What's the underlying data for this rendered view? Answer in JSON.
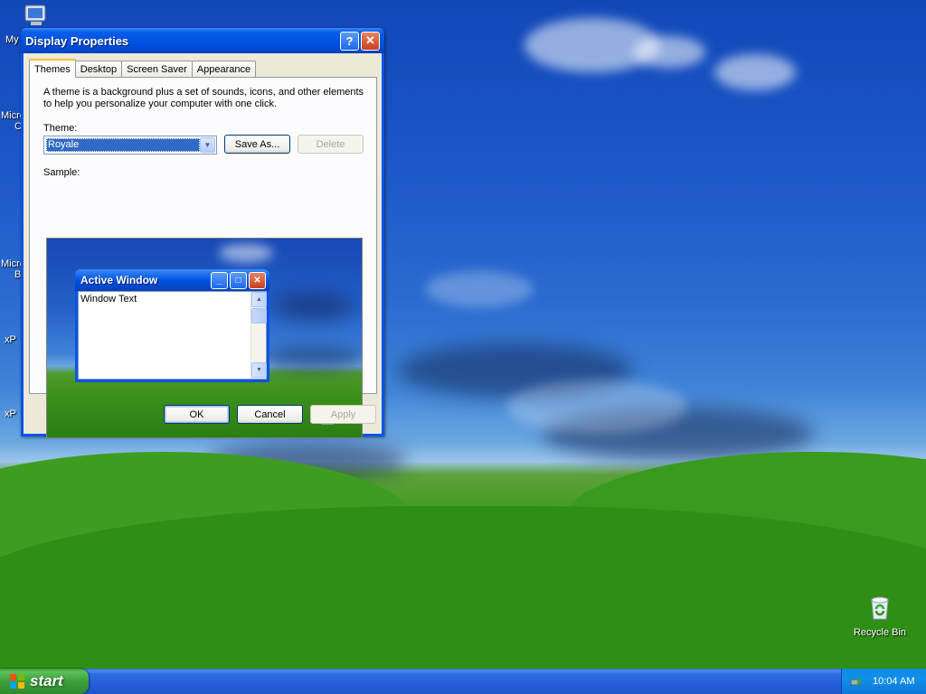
{
  "desktop": {
    "icons": [
      {
        "label": "Recycle Bin",
        "icon": "recycle-bin-icon"
      }
    ],
    "partial_labels": [
      "My",
      "Micro",
      "C",
      "Micro",
      "B",
      "xP",
      "xP"
    ]
  },
  "dialog": {
    "title": "Display Properties",
    "help_label": "?",
    "close_label": "✕",
    "tabs": [
      {
        "label": "Themes",
        "active": true
      },
      {
        "label": "Desktop",
        "active": false
      },
      {
        "label": "Screen Saver",
        "active": false
      },
      {
        "label": "Appearance",
        "active": false
      }
    ],
    "description": "A theme is a background plus a set of sounds, icons, and other elements to help you personalize your computer with one click.",
    "theme_label": "Theme:",
    "theme_value": "Royale",
    "save_as_label": "Save As...",
    "delete_label": "Delete",
    "sample_label": "Sample:",
    "sample": {
      "window_title": "Active Window",
      "window_text": "Window Text"
    },
    "ok_label": "OK",
    "cancel_label": "Cancel",
    "apply_label": "Apply"
  },
  "taskbar": {
    "start_label": "start",
    "clock": "10:04 AM"
  },
  "colors": {
    "title_bar": "#0054e3",
    "dialog_face": "#ece9d8",
    "start_button": "#3ca03c",
    "selection": "#316ac5"
  }
}
